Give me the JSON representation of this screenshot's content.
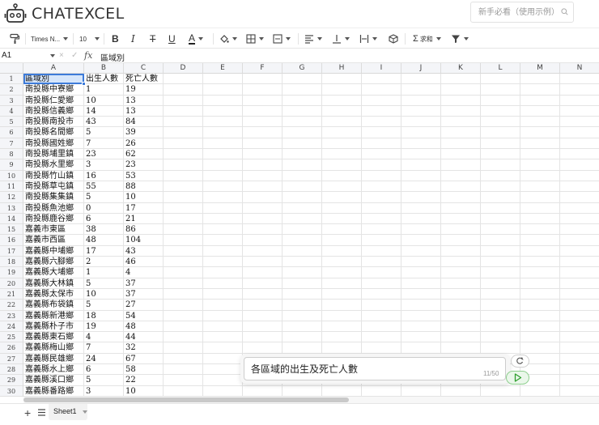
{
  "app": {
    "title": "ChatExcel"
  },
  "search": {
    "placeholder": "新手必看（使用示例）"
  },
  "toolbar": {
    "font_name": "Times N...",
    "font_size": "10",
    "bold": "B",
    "italic": "I",
    "strike": "T",
    "underline": "U",
    "font_color": "A",
    "sum_label": "求和"
  },
  "formula_bar": {
    "cell_ref": "A1",
    "content": "區域別",
    "fx": "fx",
    "cancel": "×",
    "confirm": "✓"
  },
  "columns": [
    "A",
    "B",
    "C",
    "D",
    "E",
    "F",
    "G",
    "H",
    "I",
    "J",
    "K",
    "L",
    "M",
    "N"
  ],
  "rows": [
    [
      "區域別",
      "出生人數",
      "死亡人數"
    ],
    [
      "南投縣中寮鄉",
      "1",
      "19"
    ],
    [
      "南投縣仁愛鄉",
      "10",
      "13"
    ],
    [
      "南投縣信義鄉",
      "14",
      "13"
    ],
    [
      "南投縣南投市",
      "43",
      "84"
    ],
    [
      "南投縣名間鄉",
      "5",
      "39"
    ],
    [
      "南投縣國姓鄉",
      "7",
      "26"
    ],
    [
      "南投縣埔里鎮",
      "23",
      "62"
    ],
    [
      "南投縣水里鄉",
      "3",
      "23"
    ],
    [
      "南投縣竹山鎮",
      "16",
      "53"
    ],
    [
      "南投縣草屯鎮",
      "55",
      "88"
    ],
    [
      "南投縣集集鎮",
      "5",
      "10"
    ],
    [
      "南投縣魚池鄉",
      "0",
      "17"
    ],
    [
      "南投縣鹿谷鄉",
      "6",
      "21"
    ],
    [
      "嘉義市東區",
      "38",
      "86"
    ],
    [
      "嘉義市西區",
      "48",
      "104"
    ],
    [
      "嘉義縣中埔鄉",
      "17",
      "43"
    ],
    [
      "嘉義縣六腳鄉",
      "2",
      "46"
    ],
    [
      "嘉義縣大埔鄉",
      "1",
      "4"
    ],
    [
      "嘉義縣大林鎮",
      "5",
      "37"
    ],
    [
      "嘉義縣太保市",
      "10",
      "37"
    ],
    [
      "嘉義縣布袋鎮",
      "5",
      "27"
    ],
    [
      "嘉義縣新港鄉",
      "18",
      "54"
    ],
    [
      "嘉義縣朴子市",
      "19",
      "48"
    ],
    [
      "嘉義縣東石鄉",
      "4",
      "44"
    ],
    [
      "嘉義縣梅山鄉",
      "7",
      "32"
    ],
    [
      "嘉義縣民雄鄉",
      "24",
      "67"
    ],
    [
      "嘉義縣水上鄉",
      "6",
      "58"
    ],
    [
      "嘉義縣溪口鄉",
      "5",
      "22"
    ],
    [
      "嘉義縣番路鄉",
      "3",
      "10"
    ]
  ],
  "sheets": {
    "add": "+",
    "tabs": [
      "Sheet1"
    ]
  },
  "chat": {
    "input_value": "各區域的出生及死亡人數",
    "counter": "11/50"
  },
  "colors": {
    "selection": "#3d7bd9",
    "send": "#2e9e2e"
  }
}
